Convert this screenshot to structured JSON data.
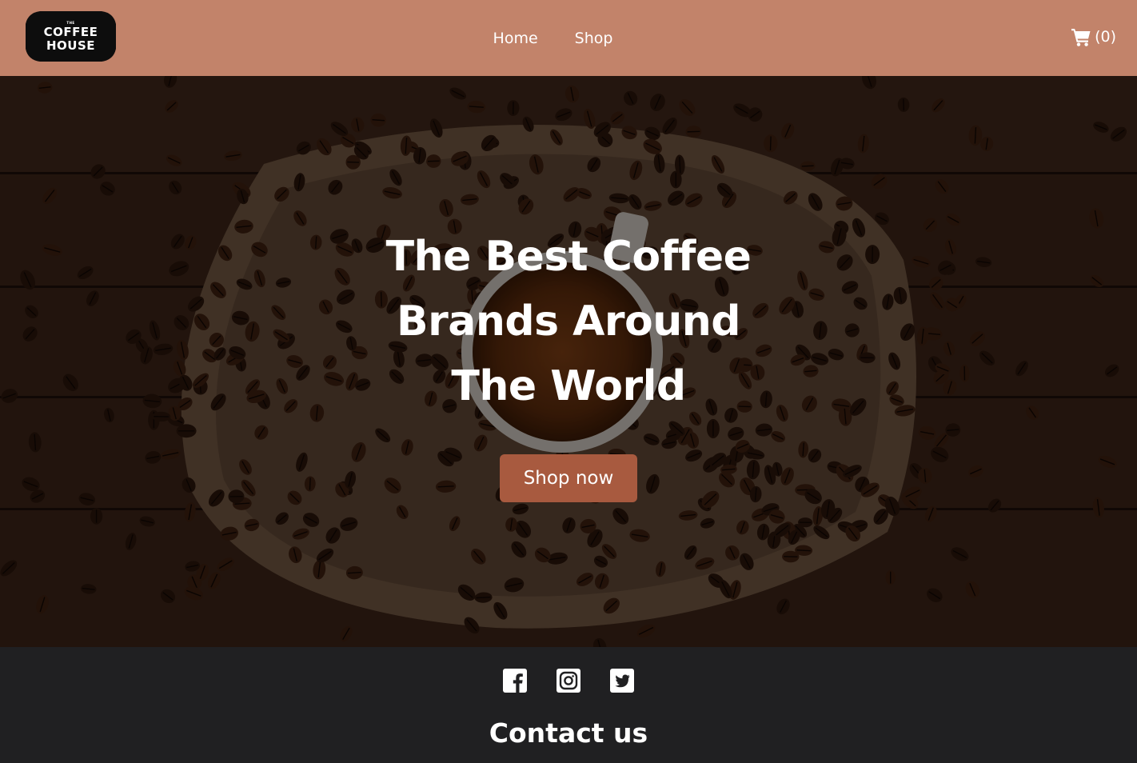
{
  "brand": {
    "logo_small": "THE",
    "logo_line1": "COFFEE",
    "logo_line2": "HOUSE"
  },
  "nav": {
    "home_label": "Home",
    "shop_label": "Shop"
  },
  "cart": {
    "count_label": "(0)",
    "icon": "shopping-cart-icon"
  },
  "hero": {
    "title_line1": "The Best Coffee",
    "title_line2": "Brands Around",
    "title_line3": "The World",
    "cta_label": "Shop now"
  },
  "footer": {
    "social": [
      {
        "icon": "facebook-icon"
      },
      {
        "icon": "instagram-icon"
      },
      {
        "icon": "twitter-icon"
      }
    ],
    "contact_heading": "Contact us"
  },
  "colors": {
    "navbar_bg": "#c2836a",
    "cta_bg": "#a85a3f",
    "footer_bg": "#202022",
    "text": "#ffffff"
  }
}
